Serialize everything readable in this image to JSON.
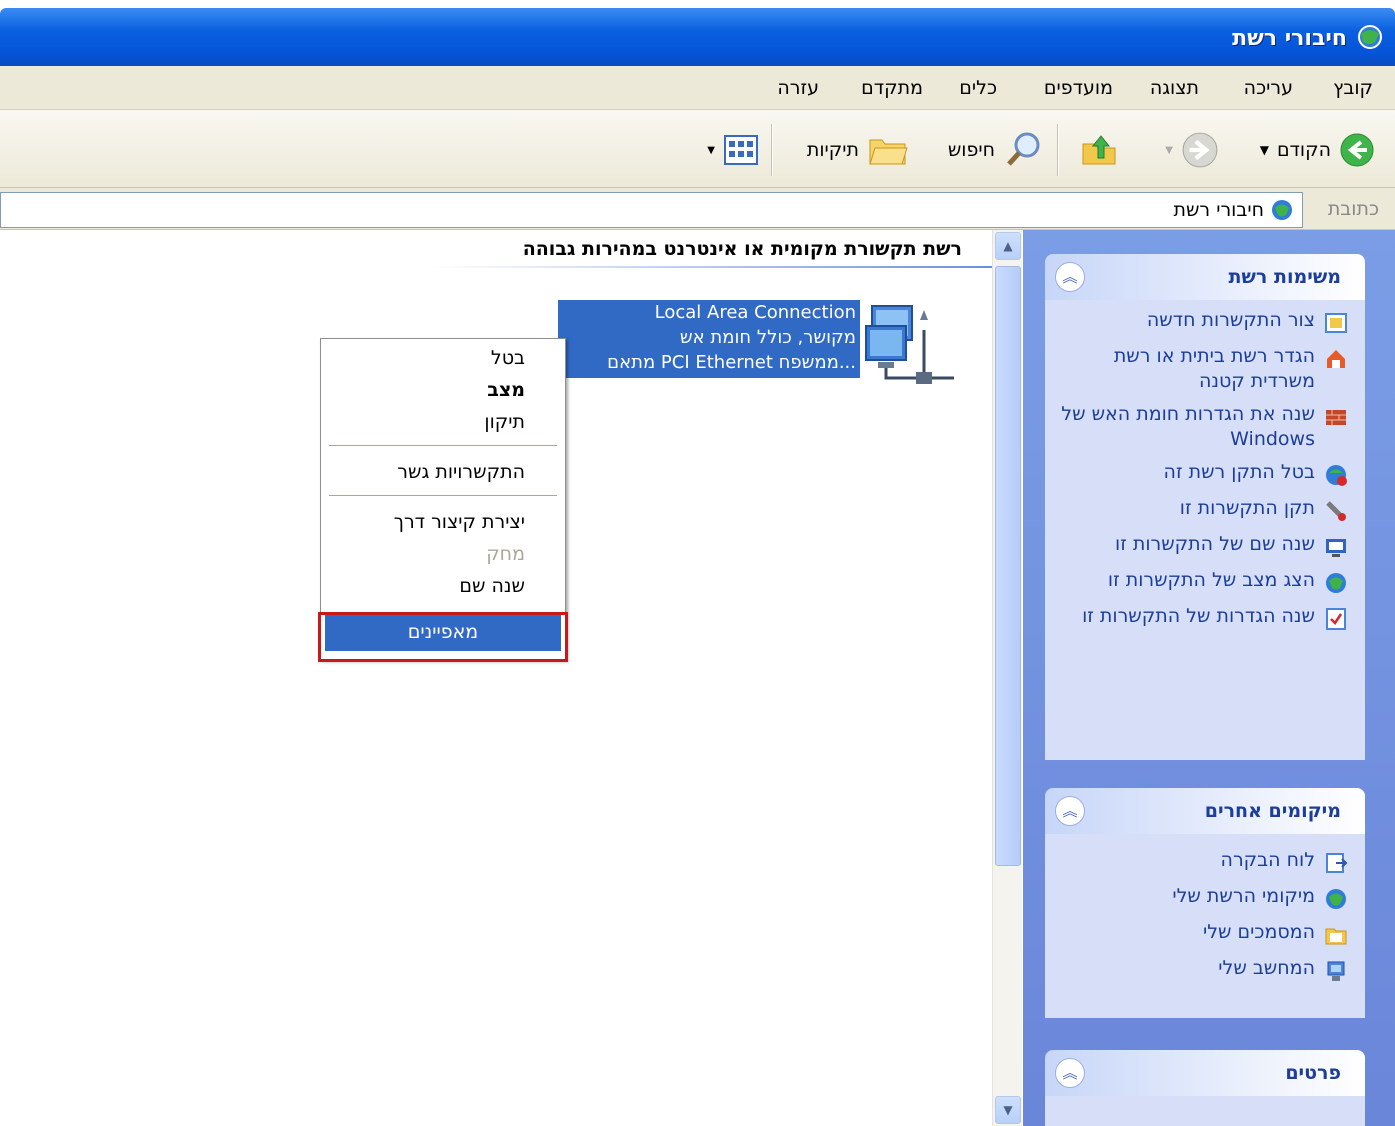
{
  "window": {
    "title": "חיבורי רשת"
  },
  "menu": [
    "קובץ",
    "עריכה",
    "תצוגה",
    "מועדפים",
    "כלים",
    "מתקדם",
    "עזרה"
  ],
  "toolbar": {
    "back_label": "הקודם",
    "search_label": "חיפוש",
    "folders_label": "תיקיות"
  },
  "address": {
    "label": "כתובת",
    "value": "חיבורי רשת"
  },
  "sidebar": {
    "network_tasks": {
      "title": "משימות רשת",
      "items": [
        "צור התקשרות חדשה",
        "הגדר רשת ביתית או רשת משרדית קטנה",
        "שנה את הגדרות חומת האש של Windows",
        "בטל התקן רשת זה",
        "תקן התקשרות זו",
        "שנה שם של התקשרות זו",
        "הצג מצב של התקשרות זו",
        "שנה הגדרות של התקשרות זו"
      ]
    },
    "other_places": {
      "title": "מיקומים אחרים",
      "items": [
        "לוח הבקרה",
        "מיקומי הרשת שלי",
        "המסמכים שלי",
        "המחשב שלי"
      ]
    },
    "details": {
      "title": "פרטים"
    }
  },
  "content": {
    "group_header": "רשת תקשורת מקומית או אינטרנט במהירות גבוהה",
    "connection": {
      "name": "Local Area Connection",
      "status": "מקושר, כולל חומת אש",
      "device": "...ממשפח PCI Ethernet מתאם"
    }
  },
  "context_menu": {
    "items": [
      "בטל",
      "מצב",
      "תיקון",
      "התקשרויות גשר",
      "יצירת קיצור דרך",
      "מחק",
      "שנה שם",
      "מאפיינים"
    ]
  },
  "colors": {
    "title_bar": "#0553d6",
    "selection": "#316ac5",
    "highlight_box": "#c81818",
    "task_pane": "#6a86d9"
  }
}
